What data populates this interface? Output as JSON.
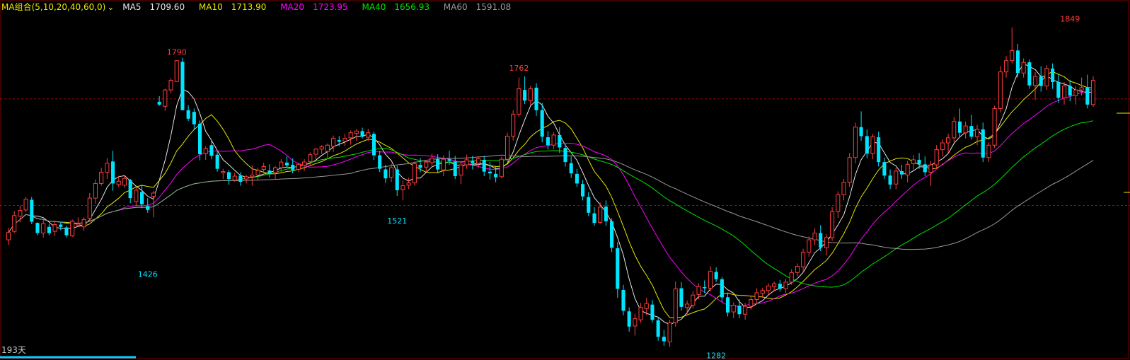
{
  "legend": {
    "group": "MA组合(5,10,20,40,60,0)",
    "group_color": "#e8e800",
    "ma5": {
      "label": "MA5",
      "value": "1709.60",
      "color": "#e6e6e6"
    },
    "ma10": {
      "label": "MA10",
      "value": "1713.90",
      "color": "#e6e600"
    },
    "ma20": {
      "label": "MA20",
      "value": "1723.95",
      "color": "#ff00ff"
    },
    "ma40": {
      "label": "MA40",
      "value": "1656.93",
      "color": "#00e600"
    },
    "ma60": {
      "label": "MA60",
      "value": "1591.08",
      "color": "#9a9a9a"
    }
  },
  "days_label": "193天",
  "chart_data": {
    "type": "candlestick",
    "title": "",
    "y_range": [
      1270,
      1870
    ],
    "reference_lines": [
      1722,
      1533
    ],
    "up_color": "#ff3c3c",
    "down_color": "#00e5ff",
    "annotations": [
      {
        "label": "1790",
        "index": 29,
        "value": 1790,
        "position": "above",
        "color": "#ff3c3c"
      },
      {
        "label": "1426",
        "index": 24,
        "value": 1426,
        "position": "below",
        "color": "#00e5ff"
      },
      {
        "label": "1762",
        "index": 88,
        "value": 1762,
        "position": "above",
        "color": "#ff3c3c"
      },
      {
        "label": "1521",
        "index": 67,
        "value": 1521,
        "position": "below",
        "color": "#00e5ff"
      },
      {
        "label": "1282",
        "index": 122,
        "value": 1282,
        "position": "below",
        "color": "#00e5ff"
      },
      {
        "label": "1849",
        "index": 183,
        "value": 1849,
        "position": "above",
        "color": "#ff3c3c"
      }
    ],
    "ohlc": [
      [
        1472,
        1493,
        1463,
        1485
      ],
      [
        1487,
        1523,
        1484,
        1515
      ],
      [
        1514,
        1533,
        1503,
        1524
      ],
      [
        1525,
        1548,
        1521,
        1544
      ],
      [
        1543,
        1548,
        1500,
        1504
      ],
      [
        1502,
        1503,
        1480,
        1484
      ],
      [
        1484,
        1509,
        1476,
        1501
      ],
      [
        1495,
        1500,
        1480,
        1484
      ],
      [
        1487,
        1504,
        1479,
        1499
      ],
      [
        1499,
        1504,
        1489,
        1495
      ],
      [
        1494,
        1497,
        1476,
        1480
      ],
      [
        1479,
        1508,
        1477,
        1505
      ],
      [
        1498,
        1512,
        1495,
        1500
      ],
      [
        1495,
        1512,
        1488,
        1508
      ],
      [
        1510,
        1555,
        1504,
        1546
      ],
      [
        1546,
        1579,
        1536,
        1572
      ],
      [
        1572,
        1600,
        1568,
        1592
      ],
      [
        1592,
        1617,
        1580,
        1608
      ],
      [
        1611,
        1630,
        1559,
        1572
      ],
      [
        1570,
        1586,
        1566,
        1576
      ],
      [
        1569,
        1585,
        1564,
        1581
      ],
      [
        1578,
        1580,
        1537,
        1546
      ],
      [
        1540,
        1565,
        1533,
        1560
      ],
      [
        1557,
        1570,
        1528,
        1535
      ],
      [
        1532,
        1546,
        1520,
        1525
      ],
      [
        1549,
        1559,
        1512,
        1555
      ],
      [
        1717,
        1727,
        1710,
        1712
      ],
      [
        1709,
        1740,
        1701,
        1738
      ],
      [
        1738,
        1759,
        1732,
        1755
      ],
      [
        1753,
        1788,
        1755,
        1790
      ],
      [
        1788,
        1795,
        1709,
        1702
      ],
      [
        1702,
        1711,
        1683,
        1687
      ],
      [
        1699,
        1705,
        1668,
        1677
      ],
      [
        1678,
        1684,
        1613,
        1624
      ],
      [
        1625,
        1638,
        1614,
        1634
      ],
      [
        1640,
        1647,
        1615,
        1621
      ],
      [
        1623,
        1629,
        1593,
        1598
      ],
      [
        1591,
        1598,
        1580,
        1593
      ],
      [
        1592,
        1596,
        1570,
        1580
      ],
      [
        1578,
        1591,
        1575,
        1585
      ],
      [
        1586,
        1592,
        1568,
        1575
      ],
      [
        1580,
        1587,
        1572,
        1584
      ],
      [
        1584,
        1604,
        1568,
        1587
      ],
      [
        1587,
        1600,
        1578,
        1595
      ],
      [
        1597,
        1609,
        1590,
        1602
      ],
      [
        1595,
        1606,
        1583,
        1590
      ],
      [
        1591,
        1603,
        1580,
        1600
      ],
      [
        1600,
        1615,
        1592,
        1610
      ],
      [
        1609,
        1620,
        1600,
        1604
      ],
      [
        1605,
        1617,
        1590,
        1596
      ],
      [
        1597,
        1609,
        1592,
        1606
      ],
      [
        1604,
        1615,
        1594,
        1610
      ],
      [
        1611,
        1627,
        1603,
        1623
      ],
      [
        1624,
        1635,
        1611,
        1633
      ],
      [
        1633,
        1640,
        1624,
        1637
      ],
      [
        1629,
        1643,
        1617,
        1640
      ],
      [
        1638,
        1657,
        1628,
        1652
      ],
      [
        1649,
        1656,
        1638,
        1646
      ],
      [
        1647,
        1660,
        1638,
        1652
      ],
      [
        1653,
        1666,
        1641,
        1662
      ],
      [
        1661,
        1669,
        1648,
        1665
      ],
      [
        1665,
        1671,
        1652,
        1655
      ],
      [
        1654,
        1669,
        1647,
        1662
      ],
      [
        1660,
        1664,
        1614,
        1622
      ],
      [
        1622,
        1630,
        1592,
        1598
      ],
      [
        1597,
        1605,
        1573,
        1581
      ],
      [
        1583,
        1607,
        1575,
        1600
      ],
      [
        1597,
        1603,
        1550,
        1560
      ],
      [
        1561,
        1577,
        1542,
        1568
      ],
      [
        1569,
        1582,
        1562,
        1573
      ],
      [
        1573,
        1611,
        1568,
        1607
      ],
      [
        1605,
        1617,
        1592,
        1600
      ],
      [
        1601,
        1614,
        1593,
        1610
      ],
      [
        1609,
        1625,
        1601,
        1617
      ],
      [
        1616,
        1624,
        1590,
        1597
      ],
      [
        1596,
        1622,
        1585,
        1615
      ],
      [
        1615,
        1630,
        1605,
        1612
      ],
      [
        1611,
        1621,
        1580,
        1585
      ],
      [
        1587,
        1610,
        1571,
        1605
      ],
      [
        1605,
        1623,
        1598,
        1614
      ],
      [
        1612,
        1621,
        1597,
        1608
      ],
      [
        1608,
        1620,
        1599,
        1616
      ],
      [
        1614,
        1621,
        1585,
        1593
      ],
      [
        1593,
        1610,
        1579,
        1590
      ],
      [
        1589,
        1603,
        1574,
        1583
      ],
      [
        1584,
        1619,
        1581,
        1615
      ],
      [
        1615,
        1662,
        1610,
        1656
      ],
      [
        1656,
        1702,
        1648,
        1695
      ],
      [
        1695,
        1760,
        1690,
        1740
      ],
      [
        1738,
        1762,
        1713,
        1719
      ],
      [
        1719,
        1745,
        1711,
        1740
      ],
      [
        1742,
        1750,
        1692,
        1702
      ],
      [
        1702,
        1715,
        1645,
        1655
      ],
      [
        1654,
        1665,
        1632,
        1640
      ],
      [
        1640,
        1663,
        1633,
        1658
      ],
      [
        1658,
        1672,
        1626,
        1636
      ],
      [
        1635,
        1642,
        1602,
        1610
      ],
      [
        1608,
        1620,
        1582,
        1590
      ],
      [
        1589,
        1598,
        1566,
        1572
      ],
      [
        1571,
        1578,
        1542,
        1549
      ],
      [
        1548,
        1557,
        1514,
        1520
      ],
      [
        1519,
        1530,
        1497,
        1502
      ],
      [
        1503,
        1538,
        1500,
        1530
      ],
      [
        1531,
        1542,
        1497,
        1505
      ],
      [
        1505,
        1510,
        1450,
        1458
      ],
      [
        1457,
        1468,
        1369,
        1385
      ],
      [
        1383,
        1392,
        1338,
        1346
      ],
      [
        1345,
        1352,
        1309,
        1318
      ],
      [
        1319,
        1341,
        1302,
        1332
      ],
      [
        1330,
        1360,
        1325,
        1352
      ],
      [
        1350,
        1369,
        1338,
        1359
      ],
      [
        1357,
        1365,
        1325,
        1330
      ],
      [
        1329,
        1335,
        1293,
        1300
      ],
      [
        1300,
        1312,
        1284,
        1292
      ],
      [
        1291,
        1330,
        1282,
        1325
      ],
      [
        1325,
        1398,
        1318,
        1385
      ],
      [
        1386,
        1397,
        1346,
        1353
      ],
      [
        1352,
        1364,
        1340,
        1358
      ],
      [
        1356,
        1381,
        1350,
        1374
      ],
      [
        1375,
        1395,
        1366,
        1389
      ],
      [
        1388,
        1400,
        1378,
        1386
      ],
      [
        1386,
        1425,
        1380,
        1416
      ],
      [
        1415,
        1423,
        1397,
        1402
      ],
      [
        1402,
        1406,
        1362,
        1370
      ],
      [
        1370,
        1377,
        1336,
        1343
      ],
      [
        1344,
        1361,
        1333,
        1356
      ],
      [
        1355,
        1366,
        1333,
        1340
      ],
      [
        1340,
        1360,
        1330,
        1354
      ],
      [
        1354,
        1372,
        1348,
        1366
      ],
      [
        1366,
        1386,
        1359,
        1378
      ],
      [
        1377,
        1387,
        1369,
        1382
      ],
      [
        1382,
        1395,
        1374,
        1390
      ],
      [
        1389,
        1398,
        1380,
        1394
      ],
      [
        1394,
        1401,
        1380,
        1385
      ],
      [
        1385,
        1403,
        1378,
        1397
      ],
      [
        1397,
        1420,
        1392,
        1414
      ],
      [
        1414,
        1430,
        1407,
        1425
      ],
      [
        1424,
        1456,
        1414,
        1450
      ],
      [
        1450,
        1478,
        1442,
        1472
      ],
      [
        1472,
        1492,
        1463,
        1484
      ],
      [
        1484,
        1498,
        1452,
        1458
      ],
      [
        1458,
        1482,
        1444,
        1476
      ],
      [
        1476,
        1530,
        1470,
        1522
      ],
      [
        1522,
        1558,
        1511,
        1552
      ],
      [
        1552,
        1580,
        1542,
        1574
      ],
      [
        1574,
        1626,
        1566,
        1618
      ],
      [
        1618,
        1680,
        1608,
        1672
      ],
      [
        1672,
        1700,
        1648,
        1656
      ],
      [
        1656,
        1668,
        1617,
        1625
      ],
      [
        1625,
        1660,
        1615,
        1655
      ],
      [
        1654,
        1664,
        1602,
        1610
      ],
      [
        1610,
        1618,
        1580,
        1586
      ],
      [
        1586,
        1597,
        1562,
        1570
      ],
      [
        1571,
        1600,
        1562,
        1594
      ],
      [
        1594,
        1605,
        1580,
        1588
      ],
      [
        1587,
        1612,
        1574,
        1606
      ],
      [
        1607,
        1622,
        1596,
        1614
      ],
      [
        1614,
        1626,
        1598,
        1606
      ],
      [
        1606,
        1620,
        1585,
        1592
      ],
      [
        1592,
        1612,
        1568,
        1605
      ],
      [
        1605,
        1640,
        1598,
        1632
      ],
      [
        1632,
        1650,
        1620,
        1644
      ],
      [
        1644,
        1660,
        1625,
        1653
      ],
      [
        1653,
        1690,
        1645,
        1682
      ],
      [
        1682,
        1705,
        1656,
        1662
      ],
      [
        1662,
        1682,
        1652,
        1674
      ],
      [
        1674,
        1694,
        1650,
        1655
      ],
      [
        1655,
        1676,
        1640,
        1668
      ],
      [
        1668,
        1680,
        1610,
        1618
      ],
      [
        1618,
        1645,
        1610,
        1640
      ],
      [
        1640,
        1710,
        1635,
        1705
      ],
      [
        1705,
        1780,
        1698,
        1770
      ],
      [
        1770,
        1798,
        1760,
        1790
      ],
      [
        1790,
        1849,
        1785,
        1808
      ],
      [
        1808,
        1820,
        1760,
        1768
      ],
      [
        1768,
        1794,
        1760,
        1787
      ],
      [
        1787,
        1792,
        1740,
        1746
      ],
      [
        1746,
        1770,
        1720,
        1762
      ],
      [
        1762,
        1780,
        1735,
        1745
      ],
      [
        1745,
        1782,
        1738,
        1776
      ],
      [
        1776,
        1785,
        1740,
        1752
      ],
      [
        1752,
        1765,
        1715,
        1724
      ],
      [
        1724,
        1752,
        1712,
        1745
      ],
      [
        1745,
        1756,
        1718,
        1728
      ],
      [
        1728,
        1745,
        1712,
        1738
      ],
      [
        1738,
        1760,
        1728,
        1742
      ],
      [
        1742,
        1765,
        1705,
        1712
      ],
      [
        1712,
        1762,
        1708,
        1755
      ]
    ]
  }
}
